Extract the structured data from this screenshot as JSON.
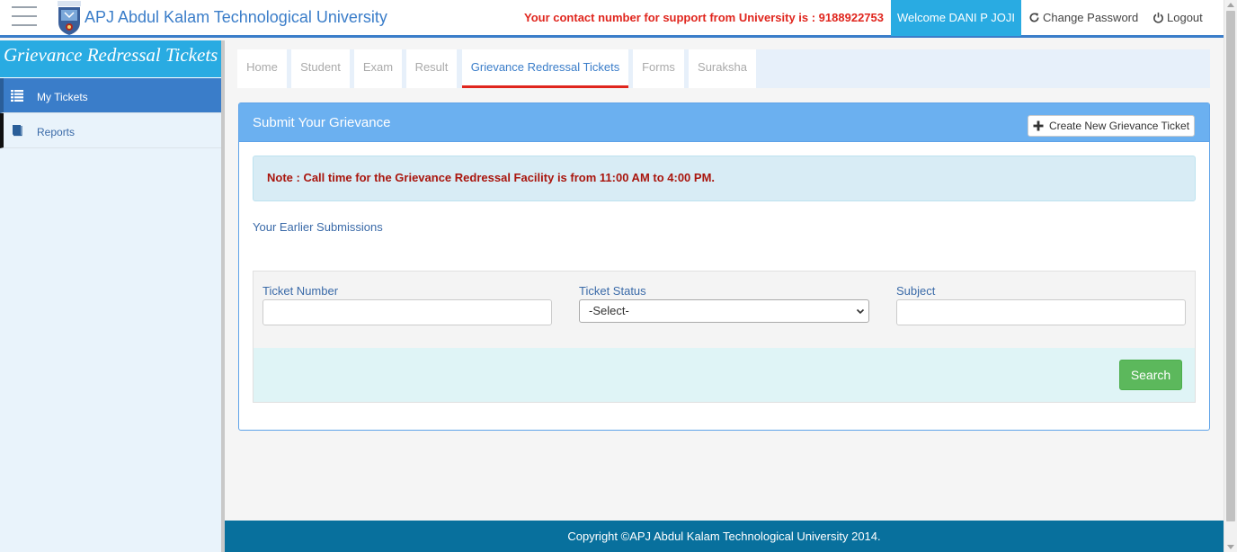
{
  "header": {
    "brand": "APJ Abdul Kalam Technological University",
    "support_text": "Your contact number for support from University is : 9188922753",
    "welcome": "Welcome DANI P JOJI",
    "change_password": "Change Password",
    "logout": "Logout"
  },
  "sidebar": {
    "title": "Grievance Redressal Tickets",
    "items": [
      {
        "label": "My Tickets",
        "icon": "list-icon",
        "active": true
      },
      {
        "label": "Reports",
        "icon": "book-icon",
        "active": false
      }
    ]
  },
  "tabs": [
    {
      "label": "Home"
    },
    {
      "label": "Student"
    },
    {
      "label": "Exam"
    },
    {
      "label": "Result"
    },
    {
      "label": "Grievance Redressal Tickets",
      "active": true
    },
    {
      "label": "Forms"
    },
    {
      "label": "Suraksha"
    }
  ],
  "panel": {
    "title": "Submit Your Grievance",
    "create_button": "Create New Grievance Ticket",
    "note": "Note : Call time for the Grievance Redressal Facility is from 11:00 AM to 4:00 PM.",
    "earlier_link": "Your Earlier Submissions"
  },
  "search": {
    "ticket_number_label": "Ticket Number",
    "ticket_number_value": "",
    "ticket_status_label": "Ticket Status",
    "ticket_status_selected": "-Select-",
    "subject_label": "Subject",
    "subject_value": "",
    "search_button": "Search"
  },
  "footer": {
    "copyright": "Copyright ©APJ Abdul Kalam Technological University 2014."
  },
  "colors": {
    "brand_blue": "#3a7dc9",
    "accent_cyan": "#29abe2",
    "alert_red": "#e0261e",
    "success_green": "#5cb85c",
    "footer_teal": "#08709d"
  }
}
